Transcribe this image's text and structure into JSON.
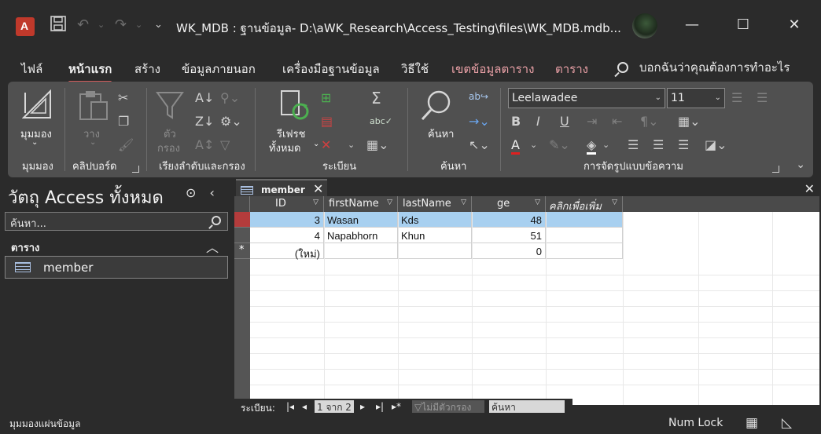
{
  "titlebar": {
    "title": "WK_MDB : ฐานข้อมูล- D:\\aWK_Research\\Access_Testing\\files\\WK_MDB.mdb...",
    "minimize": "—",
    "maximize": "☐",
    "close": "✕"
  },
  "menu": {
    "tabs": [
      "ไฟล์",
      "หน้าแรก",
      "สร้าง",
      "ข้อมูลภายนอก",
      "เครื่องมือฐานข้อมูล",
      "วิธีใช้",
      "เขตข้อมูลตาราง",
      "ตาราง"
    ],
    "active_tab": "หน้าแรก",
    "tell_me": "บอกฉันว่าคุณต้องการทำอะไร"
  },
  "ribbon": {
    "views": {
      "button": "มุมมอง",
      "group": "มุมมอง"
    },
    "clipboard": {
      "paste": "วาง",
      "group": "คลิปบอร์ด"
    },
    "sort_filter": {
      "filter": "ตัว",
      "filter2": "กรอง",
      "group": "เรียงลำดับและกรอง"
    },
    "records": {
      "refresh": "รีเฟรช",
      "refresh2": "ทั้งหมด",
      "group": "ระเบียน"
    },
    "find": {
      "button": "ค้นหา",
      "group": "ค้นหา"
    },
    "text_format": {
      "font": "Leelawadee",
      "size": "11",
      "group": "การจัดรูปแบบข้อความ"
    }
  },
  "nav": {
    "title": "วัตถุ Access ทั้งหมด",
    "search_placeholder": "ค้นหา...",
    "group": "ตาราง",
    "items": [
      "member"
    ]
  },
  "document": {
    "tab_label": "member"
  },
  "table": {
    "columns": [
      "ID",
      "firstName",
      "lastName",
      "ge",
      "คลิกเพื่อเพิ่ม"
    ],
    "rows": [
      {
        "id": "3",
        "firstName": "Wasan",
        "lastName": "Kds",
        "ge": "48"
      },
      {
        "id": "4",
        "firstName": "Napabhorn",
        "lastName": "Khun",
        "ge": "51"
      },
      {
        "id": "(ใหม่)",
        "firstName": "",
        "lastName": "",
        "ge": "0"
      }
    ]
  },
  "record_nav": {
    "label": "ระเบียน:",
    "position": "1 จาก 2",
    "filter": "ไม่มีตัวกรอง",
    "search": "ค้นหา"
  },
  "status": {
    "left": "มุมมองแผ่นข้อมูล",
    "num_lock": "Num Lock"
  },
  "colors": {
    "accent": "#d05a5a",
    "selected_row": "#a8d0f0",
    "current_record": "#b43c3c"
  }
}
